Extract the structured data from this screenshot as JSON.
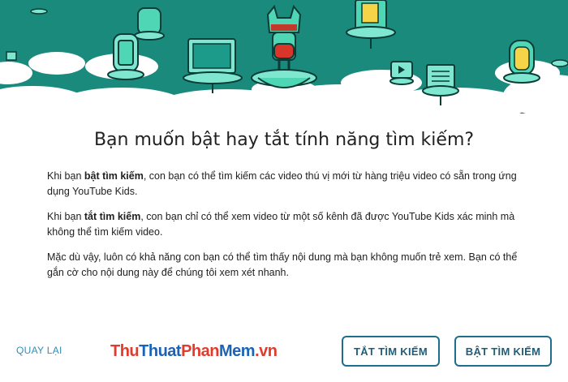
{
  "dialog": {
    "title": "Bạn muốn bật hay tắt tính năng tìm kiếm?",
    "para1": {
      "pre": "Khi bạn ",
      "bold": "bật tìm kiếm",
      "post": ", con bạn có thể tìm kiếm các video thú vị mới từ hàng triệu video có sẵn trong ứng dụng YouTube Kids."
    },
    "para2": {
      "pre": "Khi bạn ",
      "bold": "tắt tìm kiếm",
      "post": ", con bạn chỉ có thể xem video từ một số kênh đã được YouTube Kids xác minh mà không thể tìm kiếm video."
    },
    "para3": "Mặc dù vậy, luôn có khả năng con bạn có thể tìm thấy nội dung mà bạn không muốn trẻ xem. Bạn có thể gắn cờ cho nội dung này để chúng tôi xem xét nhanh."
  },
  "footer": {
    "back_label": "QUAY LẠI",
    "turn_off_label": "TẮT TÌM KIẾM",
    "turn_on_label": "BẬT TÌM KIẾM"
  },
  "watermark": {
    "part1": "Thu",
    "part2": "Thuat",
    "part3": "Phan",
    "part4": "Mem",
    "part5": ".vn"
  },
  "colors": {
    "hero_teal": "#1a8a7c",
    "accent_green": "#4fd6b5",
    "button_border": "#1f6d8c",
    "link_blue": "#2c8fb8"
  }
}
